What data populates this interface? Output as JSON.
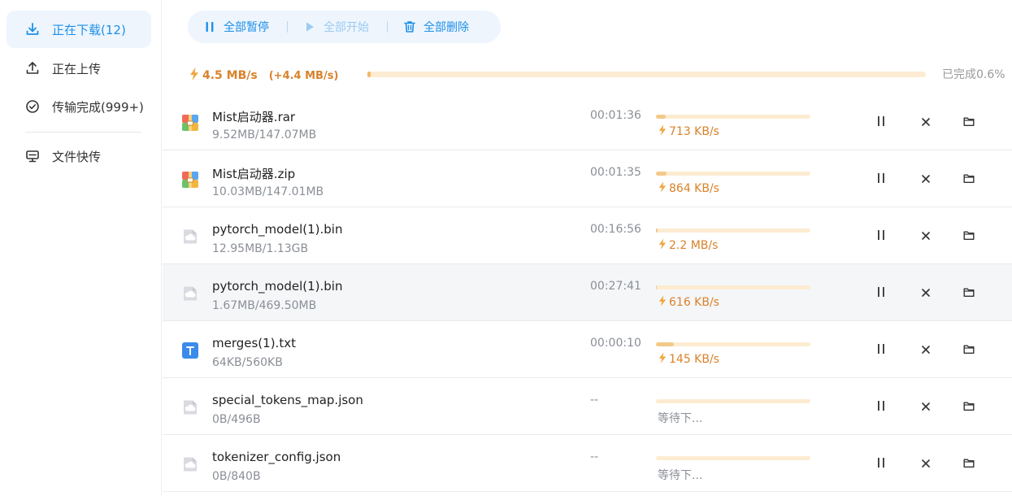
{
  "sidebar": {
    "items": [
      {
        "label": "正在下载(12)",
        "icon": "download-icon",
        "active": true
      },
      {
        "label": "正在上传",
        "icon": "upload-icon",
        "active": false
      },
      {
        "label": "传输完成(999+)",
        "icon": "check-circle-icon",
        "active": false
      },
      {
        "label": "文件快传",
        "icon": "monitor-icon",
        "active": false
      }
    ]
  },
  "toolbar": {
    "pause_all": "全部暂停",
    "start_all": "全部开始",
    "delete_all": "全部删除"
  },
  "summary": {
    "speed": "4.5 MB/s",
    "delta": "(+4.4 MB/s)",
    "completed": "已完成0.6%",
    "progress_percent": 0.6
  },
  "colors": {
    "accent": "#1e90e8",
    "speed": "#d9822b",
    "progress_track": "#fdecd2",
    "progress_fill": "#f3c98a"
  },
  "downloads": [
    {
      "name": "Mist启动器.rar",
      "size": "9.52MB/147.07MB",
      "remaining": "00:01:36",
      "speed": "713 KB/s",
      "status": "downloading",
      "icon": "archive-file-icon",
      "progress": 0.065
    },
    {
      "name": "Mist启动器.zip",
      "size": "10.03MB/147.01MB",
      "remaining": "00:01:35",
      "speed": "864 KB/s",
      "status": "downloading",
      "icon": "archive-file-icon",
      "progress": 0.068
    },
    {
      "name": "pytorch_model(1).bin",
      "size": "12.95MB/1.13GB",
      "remaining": "00:16:56",
      "speed": "2.2 MB/s",
      "status": "downloading",
      "icon": "generic-file-icon",
      "progress": 0.011
    },
    {
      "name": "pytorch_model(1).bin",
      "size": "1.67MB/469.50MB",
      "remaining": "00:27:41",
      "speed": "616 KB/s",
      "status": "downloading",
      "icon": "generic-file-icon",
      "progress": 0.004
    },
    {
      "name": "merges(1).txt",
      "size": "64KB/560KB",
      "remaining": "00:00:10",
      "speed": "145 KB/s",
      "status": "downloading",
      "icon": "text-file-icon",
      "progress": 0.114
    },
    {
      "name": "special_tokens_map.json",
      "size": "0B/496B",
      "remaining": "--",
      "wait": "等待下...",
      "status": "waiting",
      "icon": "generic-file-icon",
      "progress": 0
    },
    {
      "name": "tokenizer_config.json",
      "size": "0B/840B",
      "remaining": "--",
      "wait": "等待下...",
      "status": "waiting",
      "icon": "generic-file-icon",
      "progress": 0
    }
  ]
}
